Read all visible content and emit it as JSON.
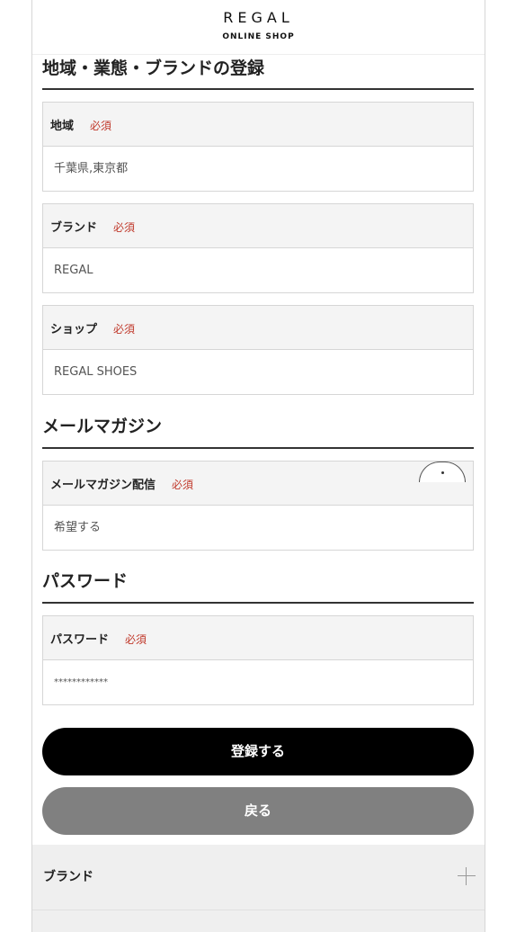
{
  "header": {
    "logo_main": "REGAL",
    "logo_sub": "ONLINE SHOP"
  },
  "section_region": {
    "title": "地域・業態・ブランドの登録"
  },
  "fields": {
    "region": {
      "label": "地域",
      "required": "必須",
      "value": "千葉県,東京都"
    },
    "brand": {
      "label": "ブランド",
      "required": "必須",
      "value": "REGAL"
    },
    "shop": {
      "label": "ショップ",
      "required": "必須",
      "value": "REGAL SHOES"
    },
    "mail": {
      "label": "メールマガジン配信",
      "required": "必須",
      "value": "希望する"
    },
    "password": {
      "label": "パスワード",
      "required": "必須",
      "value": "************"
    }
  },
  "section_mail": {
    "title": "メールマガジン"
  },
  "section_password": {
    "title": "パスワード"
  },
  "buttons": {
    "register": "登録する",
    "back": "戻る"
  },
  "footer": {
    "accordion_brand": "ブランド"
  }
}
